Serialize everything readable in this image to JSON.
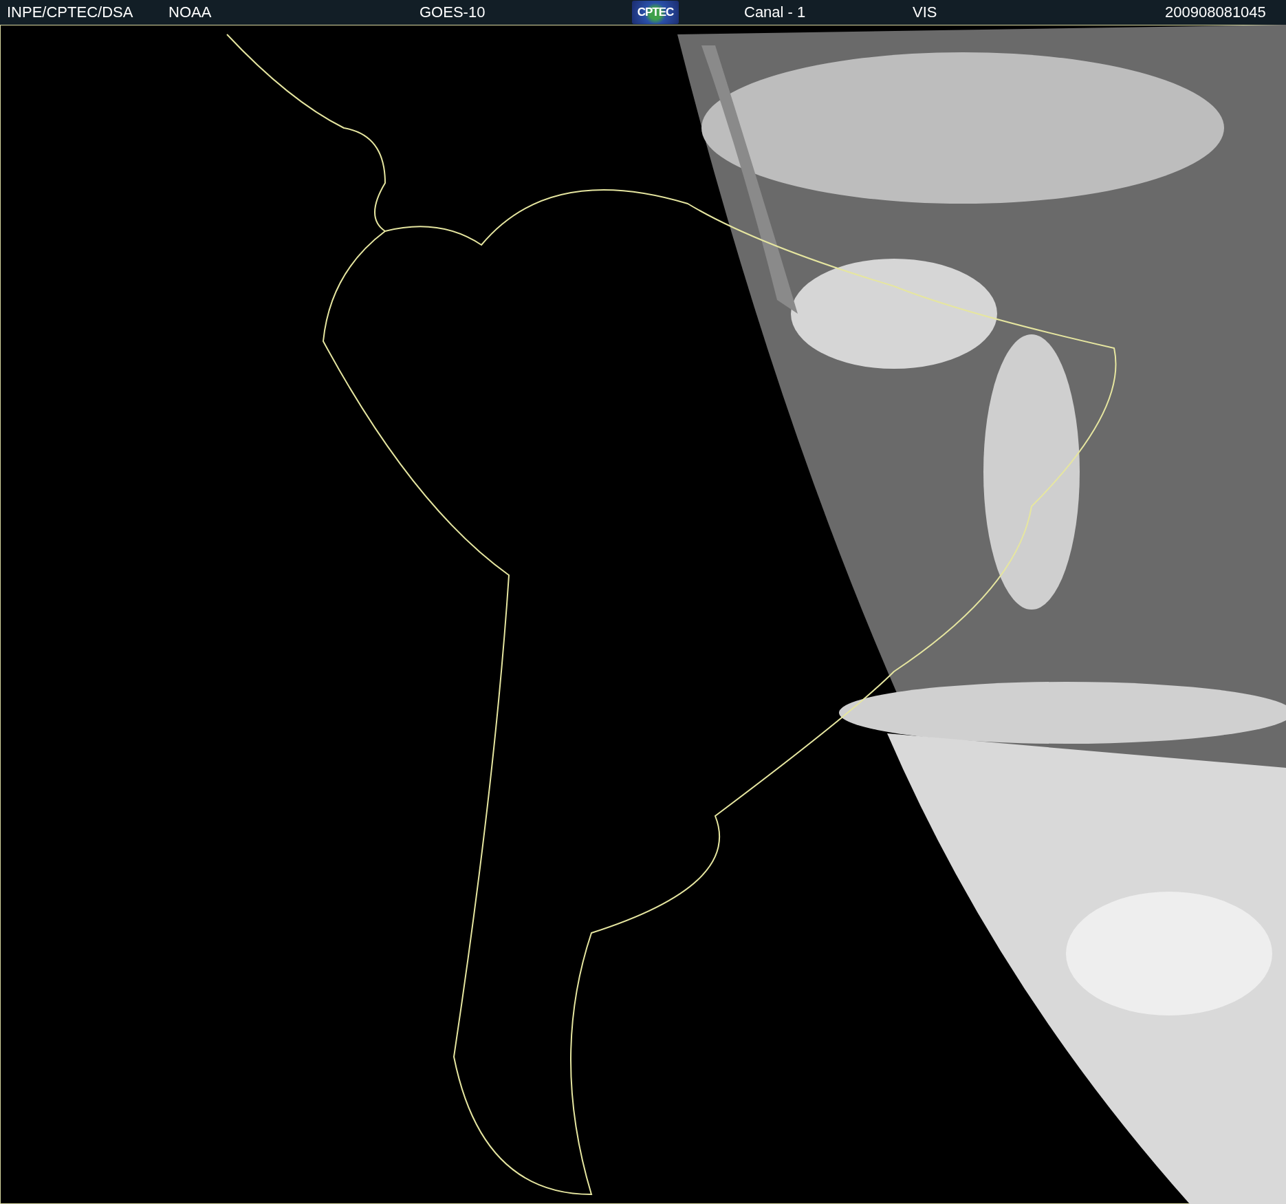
{
  "header": {
    "items": [
      {
        "kind": "text",
        "text": "INPE/CPTEC/DSA"
      },
      {
        "kind": "text",
        "text": "NOAA"
      },
      {
        "kind": "text",
        "text": "GOES-10"
      },
      {
        "kind": "logo",
        "text": "CPTEC"
      },
      {
        "kind": "text",
        "text": "Canal - 1"
      },
      {
        "kind": "text",
        "text": "VIS"
      },
      {
        "kind": "text",
        "text": "200908081045"
      }
    ]
  }
}
